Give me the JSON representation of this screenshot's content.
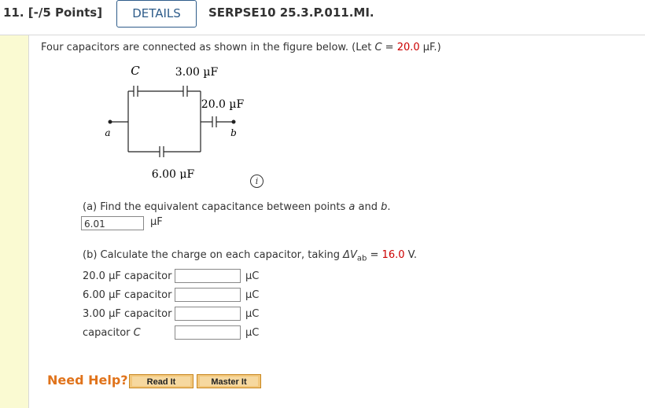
{
  "header": {
    "question_number": "11. [-/5 Points]",
    "details_label": "DETAILS",
    "question_id": "SERPSE10 25.3.P.011.MI."
  },
  "statement": {
    "text_before": "Four capacitors are connected as shown in the figure below. (Let ",
    "var": "C",
    "eq": " = ",
    "value": "20.0",
    "unit": " µF.)"
  },
  "figure": {
    "label_C": "C",
    "label_3": "3.00 µF",
    "label_20": "20.0 µF",
    "label_6": "6.00 µF",
    "label_a": "a",
    "label_b": "b"
  },
  "part_a": {
    "text_1": "(a) Find the equivalent capacitance between points ",
    "a": "a",
    "text_2": " and ",
    "b": "b",
    "text_3": ".",
    "answer": "6.01",
    "unit": "µF"
  },
  "part_b": {
    "text_1": "(b) Calculate the charge on each capacitor, taking ",
    "dv": "ΔV",
    "sub": "ab",
    "eq": " = ",
    "value": "16.0",
    "unit": " V.",
    "rows": [
      {
        "label": "20.0 µF capacitor",
        "unit": "µC"
      },
      {
        "label": "6.00 µF capacitor",
        "unit": "µC"
      },
      {
        "label": "3.00 µF capacitor",
        "unit": "µC"
      },
      {
        "label_text": "capacitor ",
        "label_var": "C",
        "unit": "µC"
      }
    ]
  },
  "help": {
    "need_help": "Need Help?",
    "read_it": "Read It",
    "master_it": "Master It"
  },
  "colors": {
    "accent": "#2e5c8a",
    "value_red": "#cc0000",
    "help_orange": "#e0731b",
    "sidebar": "#fafad2"
  }
}
